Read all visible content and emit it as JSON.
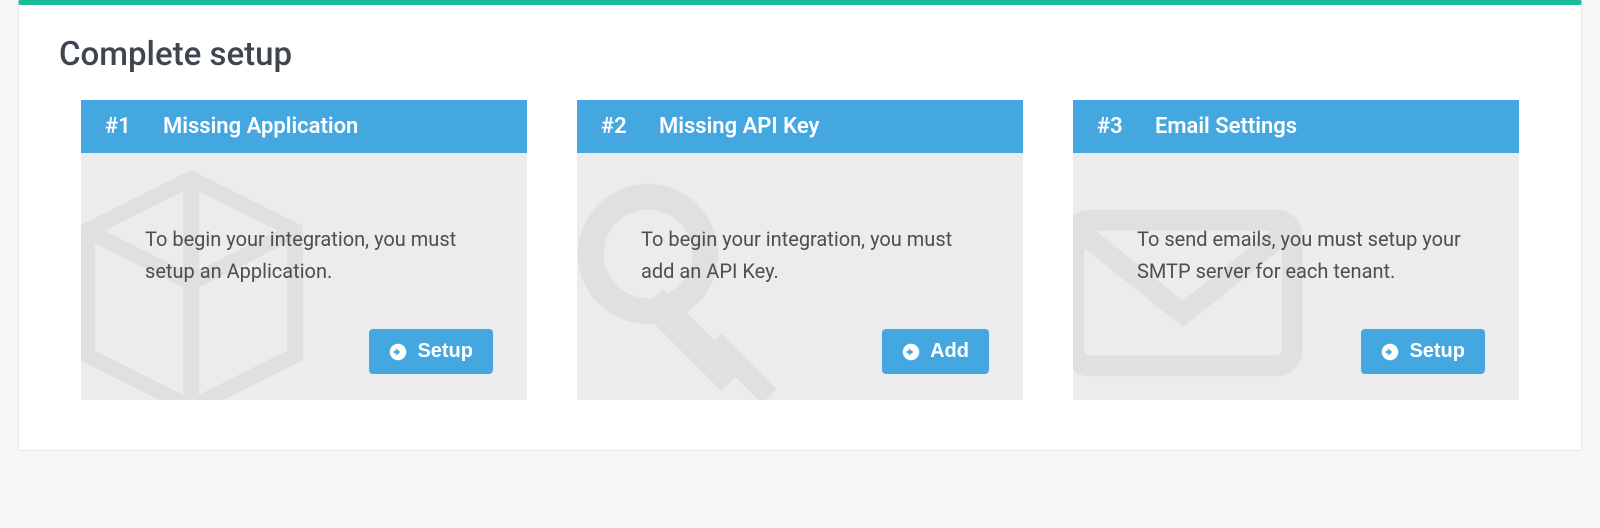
{
  "page": {
    "title": "Complete setup"
  },
  "cards": [
    {
      "number": "#1",
      "title": "Missing Application",
      "description": "To begin your integration, you must setup an Application.",
      "action_label": "Setup",
      "icon": "cube"
    },
    {
      "number": "#2",
      "title": "Missing API Key",
      "description": "To begin your integration, you must add an API Key.",
      "action_label": "Add",
      "icon": "key"
    },
    {
      "number": "#3",
      "title": "Email Settings",
      "description": "To send emails, you must setup your SMTP server for each tenant.",
      "action_label": "Setup",
      "icon": "envelope"
    }
  ],
  "colors": {
    "accent_top": "#1abc9c",
    "card_header": "#45a7e0",
    "button": "#45a7e0",
    "card_bg": "#ececec"
  }
}
